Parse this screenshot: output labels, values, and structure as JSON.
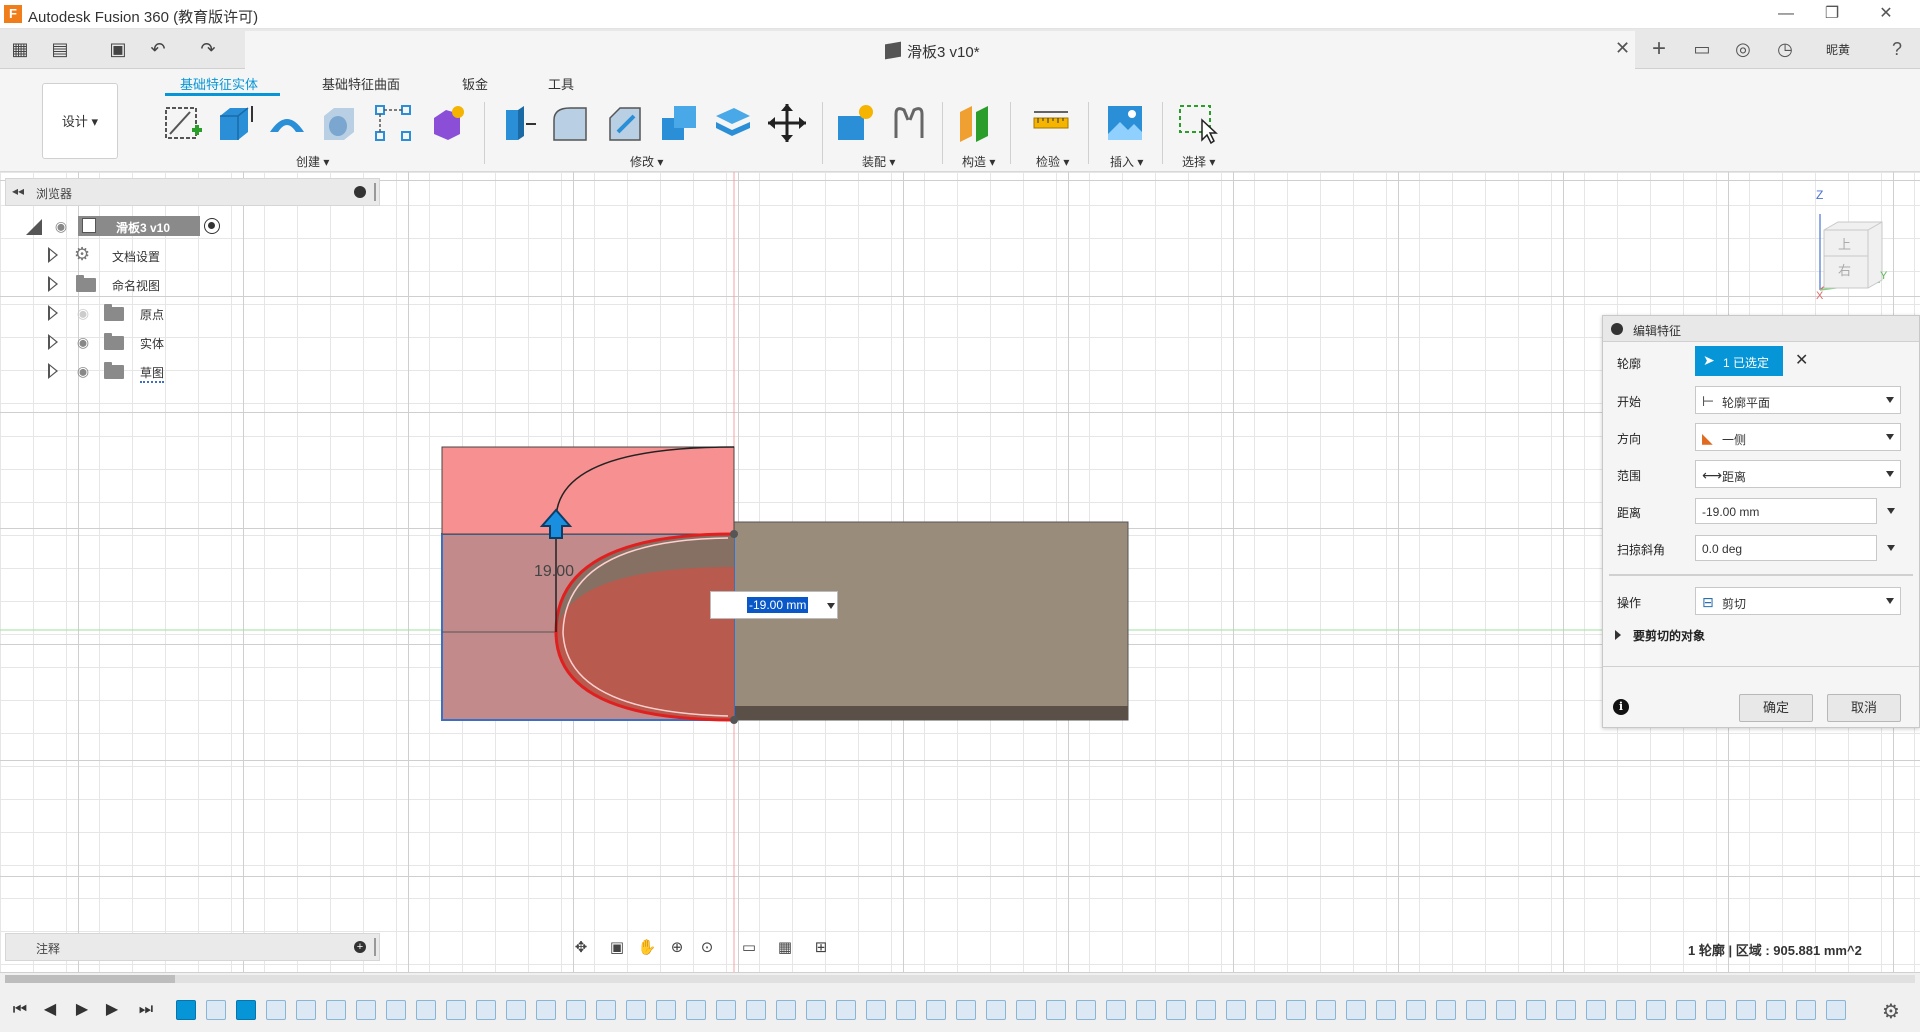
{
  "window": {
    "app_title": "Autodesk Fusion 360 (教育版许可)",
    "logo_letter": "F",
    "minimize": "—",
    "restore": "❐",
    "close": "✕"
  },
  "doc": {
    "tab_name": "滑板3 v10*",
    "close": "✕",
    "user_label": "昵黄"
  },
  "toolbar": {
    "workspace": "设计 ▾",
    "tabs": [
      "基础特征实体",
      "基础特征曲面",
      "钣金",
      "工具"
    ],
    "groups": [
      "创建 ▾",
      "修改 ▾",
      "装配 ▾",
      "构造 ▾",
      "检验 ▾",
      "插入 ▾",
      "选择 ▾"
    ]
  },
  "browser": {
    "title": "浏览器",
    "root": "滑板3 v10",
    "items": [
      "文档设置",
      "命名视图",
      "原点",
      "实体",
      "草图"
    ]
  },
  "notes": {
    "title": "注释"
  },
  "canvas": {
    "dim_label": "19.00",
    "inline_value": "-19.00 mm"
  },
  "viewcube": {
    "z": "Z",
    "y": "Y",
    "x": "X",
    "top": "上",
    "front": "右"
  },
  "dialog": {
    "title": "编辑特征",
    "rows": {
      "profile_label": "轮廓",
      "profile_value": "1 已选定",
      "start_label": "开始",
      "start_value": "轮廓平面",
      "direction_label": "方向",
      "direction_value": "一侧",
      "extent_label": "范围",
      "extent_value": "距离",
      "distance_label": "距离",
      "distance_value": "-19.00 mm",
      "taper_label": "扫掠斜角",
      "taper_value": "0.0 deg",
      "operation_label": "操作",
      "operation_value": "剪切",
      "objects_label": "要剪切的对象"
    },
    "ok": "确定",
    "cancel": "取消",
    "info": "i"
  },
  "status": {
    "text": "1 轮廓 | 区域 : 905.881 mm^2"
  },
  "colors": {
    "accent": "#0696d7",
    "body": "#9a8c7a",
    "cut_preview": "#f08080"
  }
}
